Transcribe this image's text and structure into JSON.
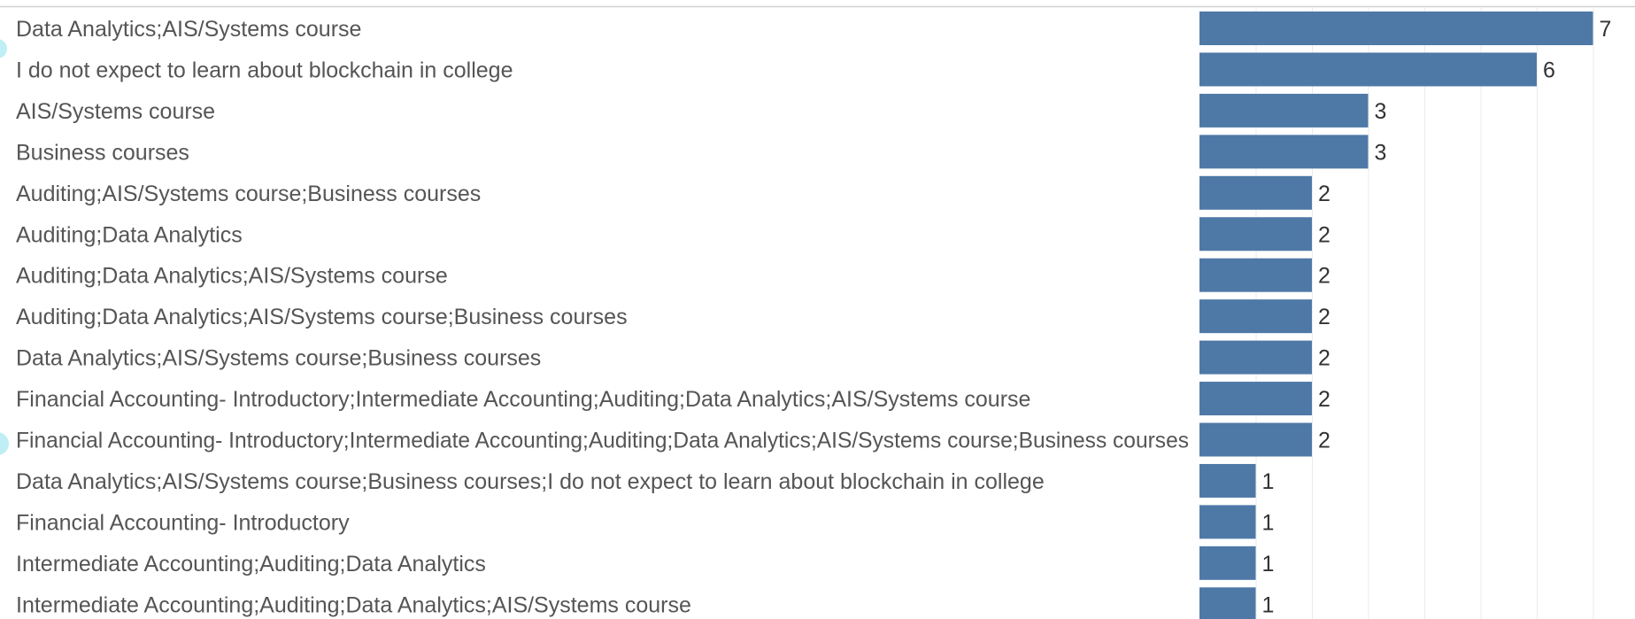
{
  "chart_data": {
    "type": "bar",
    "orientation": "horizontal",
    "title": "",
    "xlabel": "",
    "ylabel": "",
    "xlim": [
      0,
      7
    ],
    "grid": true,
    "bar_color": "#4e79a7",
    "categories": [
      "Data Analytics;AIS/Systems course",
      "I do not expect to learn about blockchain in college",
      "AIS/Systems course",
      "Business courses",
      "Auditing;AIS/Systems course;Business courses",
      "Auditing;Data Analytics",
      "Auditing;Data Analytics;AIS/Systems course",
      "Auditing;Data Analytics;AIS/Systems course;Business courses",
      "Data Analytics;AIS/Systems course;Business courses",
      "Financial Accounting- Introductory;Intermediate Accounting;Auditing;Data Analytics;AIS/Systems course",
      "Financial Accounting- Introductory;Intermediate Accounting;Auditing;Data Analytics;AIS/Systems course;Business courses",
      "Data Analytics;AIS/Systems course;Business courses;I do not expect to learn about blockchain in college",
      "Financial Accounting- Introductory",
      "Intermediate Accounting;Auditing;Data Analytics",
      "Intermediate Accounting;Auditing;Data Analytics;AIS/Systems course"
    ],
    "values": [
      7,
      6,
      3,
      3,
      2,
      2,
      2,
      2,
      2,
      2,
      2,
      1,
      1,
      1,
      1
    ]
  },
  "colors": {
    "bar": "#4e79a7",
    "label_text": "#555555",
    "value_text": "#333333",
    "gridline": "#ebebeb",
    "top_rule": "#d0d0d0"
  }
}
